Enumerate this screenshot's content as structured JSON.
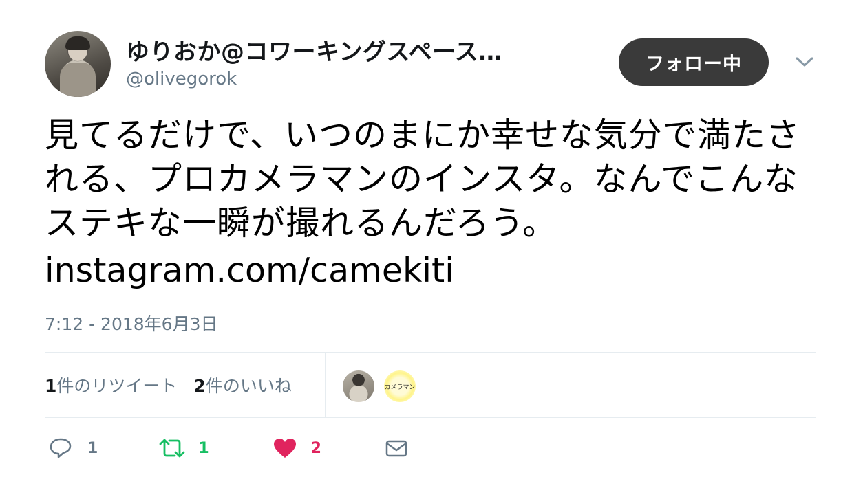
{
  "author": {
    "display_name": "ゆりおか@コワーキングスペース…",
    "screen_name": "@olivegorok"
  },
  "follow_button": {
    "label": "フォロー中"
  },
  "tweet": {
    "text": "見てるだけで、いつのまにか幸せな気分で満たされる、プロカメラマンのインスタ。なんでこんなステキな一瞬が撮れるんだろう。",
    "link": "instagram.com/camekiti",
    "timestamp": "7:12 - 2018年6月3日"
  },
  "stats": {
    "retweets_count": "1",
    "retweets_label": "件のリツイート",
    "likes_count": "2",
    "likes_label": "件のいいね"
  },
  "likers": [
    {
      "label": ""
    },
    {
      "label": "カメラマン"
    }
  ],
  "actions": {
    "reply_count": "1",
    "retweet_count": "1",
    "like_count": "2"
  },
  "colors": {
    "retweet": "#17bf63",
    "like": "#e0245e",
    "secondary_text": "#657786",
    "follow_button": "#3a3a3a"
  }
}
